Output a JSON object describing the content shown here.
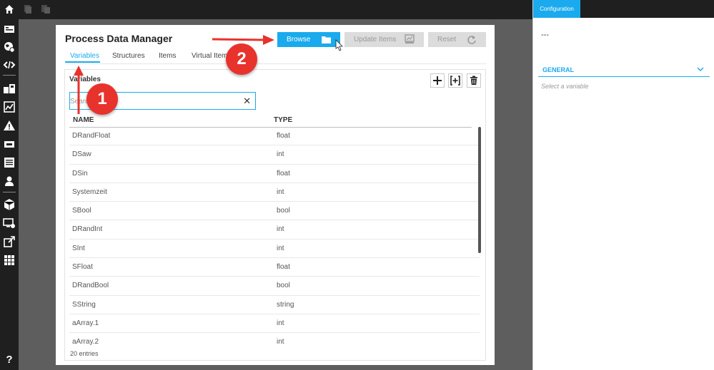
{
  "header": {
    "title": "Process Data Manager",
    "buttons": {
      "browse": "Browse",
      "update_items": "Update Items",
      "reset": "Reset"
    }
  },
  "tabs": [
    {
      "label": "Variables",
      "active": true
    },
    {
      "label": "Structures",
      "active": false
    },
    {
      "label": "Items",
      "active": false
    },
    {
      "label": "Virtual Items",
      "active": false
    }
  ],
  "variables_section": {
    "label": "Variables",
    "search_placeholder": "Search",
    "search_value": "",
    "columns": [
      "NAME",
      "TYPE"
    ],
    "rows": [
      {
        "name": "DRandFloat",
        "type": "float"
      },
      {
        "name": "DSaw",
        "type": "int"
      },
      {
        "name": "DSin",
        "type": "float"
      },
      {
        "name": "Systemzeit",
        "type": "int"
      },
      {
        "name": "SBool",
        "type": "bool"
      },
      {
        "name": "DRandInt",
        "type": "int"
      },
      {
        "name": "SInt",
        "type": "int"
      },
      {
        "name": "SFloat",
        "type": "float"
      },
      {
        "name": "DRandBool",
        "type": "bool"
      },
      {
        "name": "SString",
        "type": "string"
      },
      {
        "name": "aArray.1",
        "type": "int"
      },
      {
        "name": "aArray.2",
        "type": "int"
      }
    ],
    "entries": "20 entries"
  },
  "annotations": {
    "badge_1": "1",
    "badge_2": "2",
    "arrow_color": "#e8322c"
  },
  "right_panel": {
    "tab": "Configuration",
    "value": "---",
    "section": "GENERAL",
    "hint": "Select a variable"
  },
  "colors": {
    "accent": "#1aaaed",
    "sidebar": "#1f1f1f",
    "workspace": "#5e5e5e",
    "disabled_button": "#dcdcdc"
  },
  "icons": {
    "topbar": [
      "home-icon",
      "copy-icon",
      "paste-icon"
    ],
    "sidebar": [
      "dashboard-icon",
      "globe-icon",
      "code-icon",
      "process-data-icon",
      "chart-icon",
      "alarm-icon",
      "ticket-icon",
      "list-icon",
      "user-icon",
      "package-icon",
      "monitor-settings-icon",
      "export-icon",
      "grid-icon",
      "help-icon"
    ]
  }
}
